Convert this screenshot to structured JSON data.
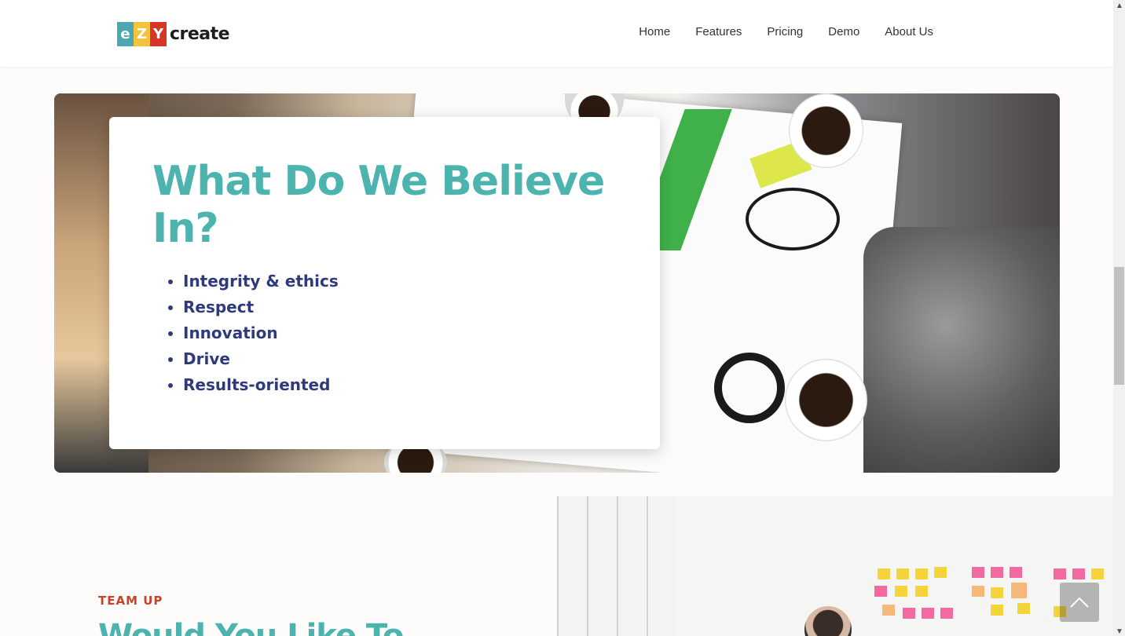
{
  "logo": {
    "letters": [
      "e",
      "Z",
      "Y"
    ],
    "word": "create"
  },
  "nav": {
    "items": [
      "Home",
      "Features",
      "Pricing",
      "Demo",
      "About Us"
    ]
  },
  "beliefs": {
    "title": "What Do We Believe In?",
    "items": [
      "Integrity & ethics",
      "Respect",
      "Innovation",
      "Drive",
      "Results-oriented"
    ]
  },
  "team": {
    "label": "TEAM UP",
    "title": "Would You Like To"
  },
  "colors": {
    "teal": "#4cb3ae",
    "navy": "#2f3a7d",
    "red": "#c8422a"
  },
  "icons": {
    "scroll_top": "chevron-up-icon"
  }
}
